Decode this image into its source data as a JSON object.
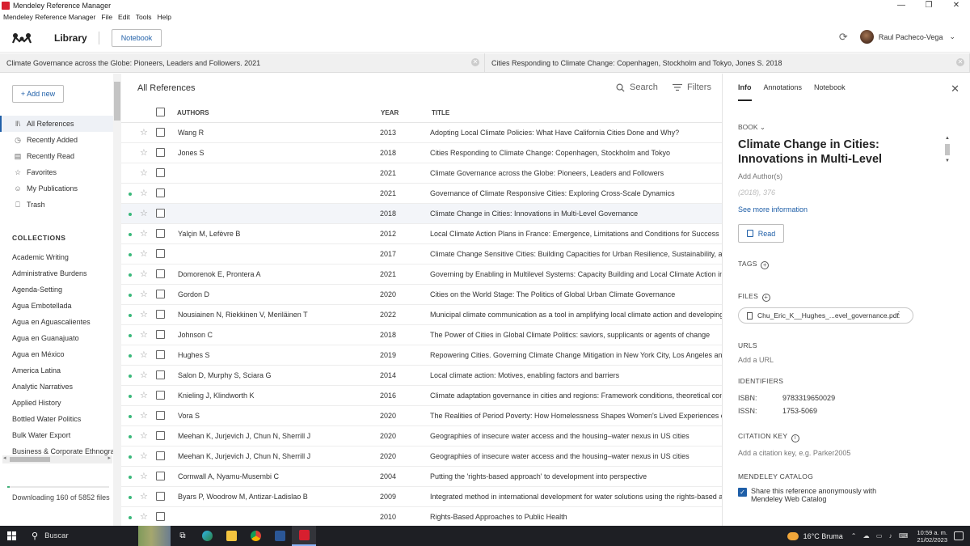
{
  "window": {
    "title": "Mendeley Reference Manager",
    "controls": [
      "—",
      "❐",
      "✕"
    ]
  },
  "menu": [
    "Mendeley Reference Manager",
    "File",
    "Edit",
    "Tools",
    "Help"
  ],
  "header": {
    "library_label": "Library",
    "notebook_label": "Notebook",
    "user_name": "Raul Pacheco-Vega"
  },
  "open_tabs": [
    "Climate Governance across the Globe: Pioneers, Leaders and Followers. 2021",
    "Cities Responding to Climate Change: Copenhagen, Stockholm and Tokyo, Jones S. 2018"
  ],
  "sidebar": {
    "add_new": "+ Add new",
    "nav": [
      {
        "label": "All References",
        "icon": "library-icon",
        "glyph": "‖\\"
      },
      {
        "label": "Recently Added",
        "icon": "clock-icon",
        "glyph": "◷"
      },
      {
        "label": "Recently Read",
        "icon": "book-icon",
        "glyph": "▤"
      },
      {
        "label": "Favorites",
        "icon": "star-icon",
        "glyph": "☆"
      },
      {
        "label": "My Publications",
        "icon": "person-icon",
        "glyph": "☺"
      },
      {
        "label": "Trash",
        "icon": "trash-icon",
        "glyph": "⎕"
      }
    ],
    "collections_heading": "COLLECTIONS",
    "collections": [
      "Academic Writing",
      "Administrative Burdens",
      "Agenda-Setting",
      "Agua Embotellada",
      "Agua en Aguascalientes",
      "Agua en Guanajuato",
      "Agua en México",
      "America Latina",
      "Analytic Narratives",
      "Applied History",
      "Bottled Water Politics",
      "Bulk Water Export",
      "Business & Corporate Ethnogra"
    ],
    "download_status": "Downloading 160 of 5852 files",
    "download_progress": 0.027
  },
  "list": {
    "heading": "All References",
    "search_label": "Search",
    "filters_label": "Filters",
    "columns": {
      "authors": "AUTHORS",
      "year": "YEAR",
      "title": "TITLE"
    },
    "rows": [
      {
        "dot": false,
        "authors": "Wang R",
        "year": "2013",
        "title": "Adopting Local Climate Policies: What Have California Cities Done and Why?"
      },
      {
        "dot": false,
        "authors": "Jones S",
        "year": "2018",
        "title": "Cities Responding to Climate Change: Copenhagen, Stockholm and Tokyo"
      },
      {
        "dot": false,
        "authors": "",
        "year": "2021",
        "title": "Climate Governance across the Globe: Pioneers, Leaders and Followers"
      },
      {
        "dot": true,
        "authors": "",
        "year": "2021",
        "title": "Governance of Climate Responsive Cities: Exploring Cross-Scale Dynamics"
      },
      {
        "dot": true,
        "authors": "",
        "year": "2018",
        "title": "Climate Change in Cities: Innovations in Multi-Level Governance",
        "selected": true
      },
      {
        "dot": true,
        "authors": "Yalçin M, Lefèvre B",
        "year": "2012",
        "title": "Local Climate Action Plans in France: Emergence, Limitations and Conditions for Success"
      },
      {
        "dot": true,
        "authors": "",
        "year": "2017",
        "title": "Climate Change Sensitive Cities: Building Capacities for Urban Resilience, Sustainability, and"
      },
      {
        "dot": true,
        "authors": "Domorenok E, Prontera A",
        "year": "2021",
        "title": "Governing by Enabling in Multilevel Systems: Capacity Building and Local Climate Action in th"
      },
      {
        "dot": true,
        "authors": "Gordon D",
        "year": "2020",
        "title": "Cities on the World Stage: The Politics of Global Urban Climate Governance"
      },
      {
        "dot": true,
        "authors": "Nousiainen N, Riekkinen V, Meriläinen T",
        "year": "2022",
        "title": "Municipal climate communication as a tool in amplifying local climate action and developing a"
      },
      {
        "dot": true,
        "authors": "Johnson C",
        "year": "2018",
        "title": "The Power of Cities in Global Climate Politics: saviors, supplicants or agents of change"
      },
      {
        "dot": true,
        "authors": "Hughes S",
        "year": "2019",
        "title": "Repowering Cities. Governing Climate Change Mitigation in New York City, Los Angeles and T"
      },
      {
        "dot": true,
        "authors": "Salon D, Murphy S, Sciara G",
        "year": "2014",
        "title": "Local climate action: Motives, enabling factors and barriers"
      },
      {
        "dot": true,
        "authors": "Knieling J, Klindworth K",
        "year": "2016",
        "title": "Climate adaptation governance in cities and regions: Framework conditions, theoretical conce"
      },
      {
        "dot": true,
        "authors": "Vora S",
        "year": "2020",
        "title": "The Realities of Period Poverty: How Homelessness Shapes Women's Lived Experiences of"
      },
      {
        "dot": true,
        "authors": "Meehan K, Jurjevich J, Chun N, Sherrill J",
        "year": "2020",
        "title": "Geographies of insecure water access and the housing–water nexus in US cities"
      },
      {
        "dot": true,
        "authors": "Meehan K, Jurjevich J, Chun N, Sherrill J",
        "year": "2020",
        "title": "Geographies of insecure water access and the housing–water nexus in US cities"
      },
      {
        "dot": true,
        "authors": "Cornwall A, Nyamu-Musembi C",
        "year": "2004",
        "title": "Putting the 'rights-based approach' to development into perspective"
      },
      {
        "dot": true,
        "authors": "Byars P, Woodrow M, Antizar-Ladislao B",
        "year": "2009",
        "title": "Integrated method in international development for water solutions using the rights-based app"
      },
      {
        "dot": true,
        "authors": "",
        "year": "2010",
        "title": "Rights-Based Approaches to Public Health"
      }
    ]
  },
  "details": {
    "tabs": [
      "Info",
      "Annotations",
      "Notebook"
    ],
    "type": "BOOK",
    "title": "Climate Change in Cities: Innovations in Multi-Level",
    "add_author": "Add Author(s)",
    "meta": "(2018), 376",
    "see_more": "See more information",
    "read_label": "Read",
    "tags_heading": "TAGS",
    "files_heading": "FILES",
    "file_name": "Chu_Eric_K__Hughes_...evel_governance.pdf",
    "urls_heading": "URLS",
    "add_url": "Add a URL",
    "identifiers_heading": "IDENTIFIERS",
    "isbn_label": "ISBN:",
    "isbn": "9783319650029",
    "issn_label": "ISSN:",
    "issn": "1753-5069",
    "citation_key_heading": "CITATION KEY",
    "citation_key_placeholder": "Add a citation key, e.g. Parker2005",
    "catalog_heading": "MENDELEY CATALOG",
    "share_text": "Share this reference anonymously with Mendeley Web Catalog"
  },
  "taskbar": {
    "search_label": "Buscar",
    "weather": "16°C  Bruma",
    "time": "10:59 a. m.",
    "date": "21/02/2023"
  }
}
